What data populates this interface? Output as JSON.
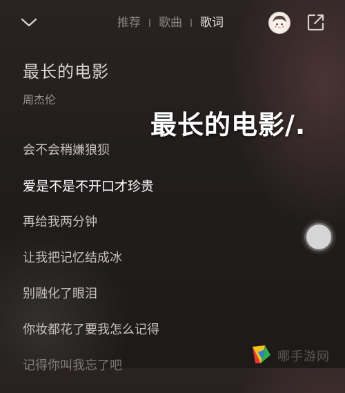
{
  "header": {
    "tabs": [
      {
        "label": "推荐"
      },
      {
        "label": "歌曲"
      },
      {
        "label": "歌词"
      }
    ],
    "active_tab": "歌词"
  },
  "song": {
    "title": "最长的电影",
    "artist": "周杰伦"
  },
  "overlay": {
    "text": "最长的电影/."
  },
  "lyrics": [
    {
      "text": "会不会稍嫌狼狈"
    },
    {
      "text": "爱是不是不开口才珍贵"
    },
    {
      "text": "再给我两分钟"
    },
    {
      "text": "让我把记忆结成冰"
    },
    {
      "text": "别融化了眼泪"
    },
    {
      "text": "你妆都花了要我怎么记得"
    },
    {
      "text": "记得你叫我忘了吧"
    }
  ],
  "watermark": {
    "text": "哪手游网"
  },
  "icons": {
    "back": "chevron-down-icon",
    "share": "share-icon",
    "avatar": "avatar",
    "floating": "floating-ball-icon",
    "logo": "watermark-logo"
  },
  "colors": {
    "active_tab": "#e6e1e1",
    "inactive_tab": "#8c8585",
    "active_lyric": "#ffffff",
    "lyric": "#c7c0c0"
  }
}
